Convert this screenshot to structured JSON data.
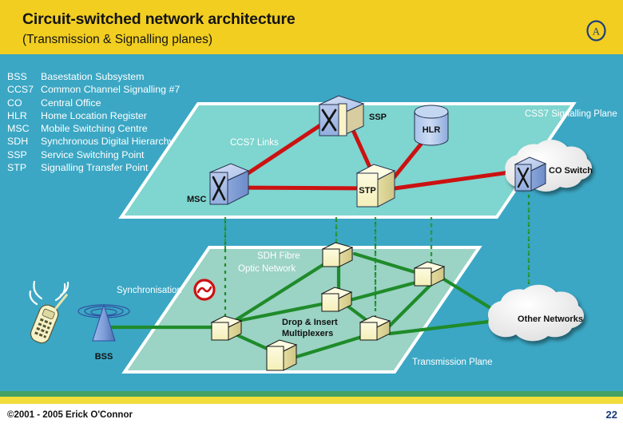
{
  "header": {
    "title": "Circuit-switched network architecture",
    "subtitle": "(Transmission & Signalling planes)",
    "logo": "circled-a-logo",
    "bg_color": "#f2ce21"
  },
  "theme": {
    "page_bg": "#3ba7c4",
    "signalling_plane_fill": "#7fd5cf",
    "transmission_plane_fill": "#9bd3c4",
    "signalling_link_color": "#cc1111",
    "transmission_link_color": "#1f8b2a",
    "sync_dotted_color": "#1f8b2a",
    "switch_face_color": "#9fb6e0",
    "mux_face_color": "#fbf8cd",
    "cloud_color": "#f2f2f2",
    "band_green": "#45a163",
    "band_yellow": "#f2dd3a"
  },
  "legend": {
    "items": [
      {
        "abbr": "BSS",
        "text": "Basestation Subsystem"
      },
      {
        "abbr": "CCS7",
        "text": "Common Channel Signalling #7"
      },
      {
        "abbr": "CO",
        "text": "Central Office"
      },
      {
        "abbr": "HLR",
        "text": "Home Location Register"
      },
      {
        "abbr": "MSC",
        "text": "Mobile Switching Centre"
      },
      {
        "abbr": "SDH",
        "text": "Synchronous Digital Hierarchy"
      },
      {
        "abbr": "SSP",
        "text": "Service Switching Point"
      },
      {
        "abbr": "STP",
        "text": "Signalling Transfer Point"
      }
    ]
  },
  "diagram": {
    "planes": [
      {
        "name": "signalling-plane",
        "label": "CSS7 Signalling Plane"
      },
      {
        "name": "transmission-plane",
        "label": "Transmission Plane"
      }
    ],
    "labels": {
      "ccs7_links": "CCS7 Links",
      "signalling_plane": "CSS7 Signalling Plane",
      "co_switch": "CO Switch",
      "ssp": "SSP",
      "hlr": "HLR",
      "stp": "STP",
      "msc": "MSC",
      "sdh_network_line1": "SDH Fibre",
      "sdh_network_line2": "Optic Network",
      "synchronisation": "Synchronisation",
      "drop_insert_line1": "Drop & Insert",
      "drop_insert_line2": "Multiplexers",
      "bss": "BSS",
      "other_networks": "Other Networks",
      "transmission_plane": "Transmission Plane"
    },
    "nodes": [
      {
        "id": "msc",
        "label": "MSC",
        "type": "switch",
        "plane": "signalling"
      },
      {
        "id": "ssp",
        "label": "SSP",
        "type": "switch",
        "plane": "signalling"
      },
      {
        "id": "stp",
        "label": "STP",
        "type": "box",
        "plane": "signalling"
      },
      {
        "id": "hlr",
        "label": "HLR",
        "type": "cylinder",
        "plane": "signalling"
      },
      {
        "id": "co-switch",
        "label": "CO Switch",
        "type": "switch-in-cloud",
        "plane": "signalling"
      },
      {
        "id": "mux-1",
        "label": "",
        "type": "multiplexer",
        "plane": "transmission"
      },
      {
        "id": "mux-2",
        "label": "",
        "type": "multiplexer",
        "plane": "transmission"
      },
      {
        "id": "mux-3",
        "label": "",
        "type": "multiplexer",
        "plane": "transmission"
      },
      {
        "id": "mux-4",
        "label": "",
        "type": "multiplexer",
        "plane": "transmission"
      },
      {
        "id": "mux-5",
        "label": "",
        "type": "multiplexer",
        "plane": "transmission"
      },
      {
        "id": "mux-6",
        "label": "",
        "type": "multiplexer",
        "plane": "transmission"
      },
      {
        "id": "bss-antenna",
        "label": "BSS",
        "type": "antenna",
        "plane": "transmission"
      },
      {
        "id": "mobile-handset",
        "label": "",
        "type": "mobile-phone",
        "plane": "none"
      },
      {
        "id": "other-networks",
        "label": "Other Networks",
        "type": "cloud",
        "plane": "transmission"
      },
      {
        "id": "sync-source",
        "label": "Synchronisation",
        "type": "sync-symbol",
        "plane": "transmission"
      }
    ]
  },
  "footer": {
    "copyright": "©2001 - 2005 Erick O'Connor",
    "page_number": "22"
  }
}
